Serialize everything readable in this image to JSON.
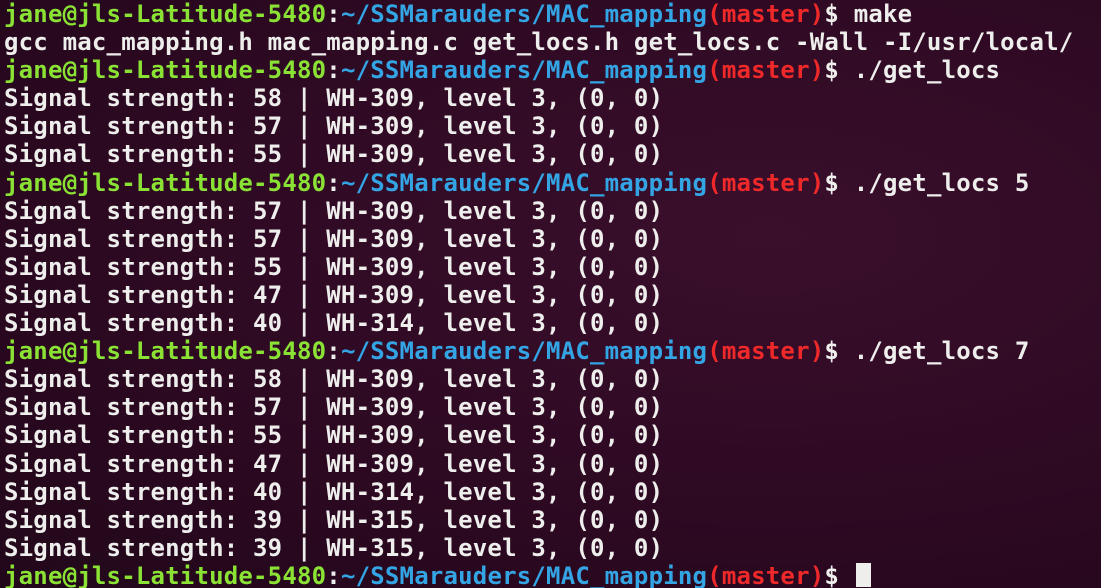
{
  "terminal": {
    "colors": {
      "background": "#300a24",
      "user": "#8ae234",
      "path": "#34a5e4",
      "branch": "#ef2929",
      "text": "#eeeeec"
    },
    "lines": [
      {
        "type": "prompt",
        "user": "jane@jls-Latitude-5480",
        "sep": ":",
        "path": "~/SSMarauders/MAC_mapping",
        "branch": "(master)",
        "sym": "$ ",
        "command": "make"
      },
      {
        "type": "output",
        "text": "gcc mac_mapping.h mac_mapping.c get_locs.h get_locs.c -Wall -I/usr/local/"
      },
      {
        "type": "prompt",
        "user": "jane@jls-Latitude-5480",
        "sep": ":",
        "path": "~/SSMarauders/MAC_mapping",
        "branch": "(master)",
        "sym": "$ ",
        "command": "./get_locs"
      },
      {
        "type": "output",
        "text": "Signal strength: 58 | WH-309, level 3, (0, 0)"
      },
      {
        "type": "output",
        "text": "Signal strength: 57 | WH-309, level 3, (0, 0)"
      },
      {
        "type": "output",
        "text": "Signal strength: 55 | WH-309, level 3, (0, 0)"
      },
      {
        "type": "prompt",
        "user": "jane@jls-Latitude-5480",
        "sep": ":",
        "path": "~/SSMarauders/MAC_mapping",
        "branch": "(master)",
        "sym": "$ ",
        "command": "./get_locs 5"
      },
      {
        "type": "output",
        "text": "Signal strength: 57 | WH-309, level 3, (0, 0)"
      },
      {
        "type": "output",
        "text": "Signal strength: 57 | WH-309, level 3, (0, 0)"
      },
      {
        "type": "output",
        "text": "Signal strength: 55 | WH-309, level 3, (0, 0)"
      },
      {
        "type": "output",
        "text": "Signal strength: 47 | WH-309, level 3, (0, 0)"
      },
      {
        "type": "output",
        "text": "Signal strength: 40 | WH-314, level 3, (0, 0)"
      },
      {
        "type": "prompt",
        "user": "jane@jls-Latitude-5480",
        "sep": ":",
        "path": "~/SSMarauders/MAC_mapping",
        "branch": "(master)",
        "sym": "$ ",
        "command": "./get_locs 7"
      },
      {
        "type": "output",
        "text": "Signal strength: 58 | WH-309, level 3, (0, 0)"
      },
      {
        "type": "output",
        "text": "Signal strength: 57 | WH-309, level 3, (0, 0)"
      },
      {
        "type": "output",
        "text": "Signal strength: 55 | WH-309, level 3, (0, 0)"
      },
      {
        "type": "output",
        "text": "Signal strength: 47 | WH-309, level 3, (0, 0)"
      },
      {
        "type": "output",
        "text": "Signal strength: 40 | WH-314, level 3, (0, 0)"
      },
      {
        "type": "output",
        "text": "Signal strength: 39 | WH-315, level 3, (0, 0)"
      },
      {
        "type": "output",
        "text": "Signal strength: 39 | WH-315, level 3, (0, 0)"
      },
      {
        "type": "prompt",
        "user": "jane@jls-Latitude-5480",
        "sep": ":",
        "path": "~/SSMarauders/MAC_mapping",
        "branch": "(master)",
        "sym": "$ ",
        "command": "",
        "cursor": true
      }
    ]
  }
}
